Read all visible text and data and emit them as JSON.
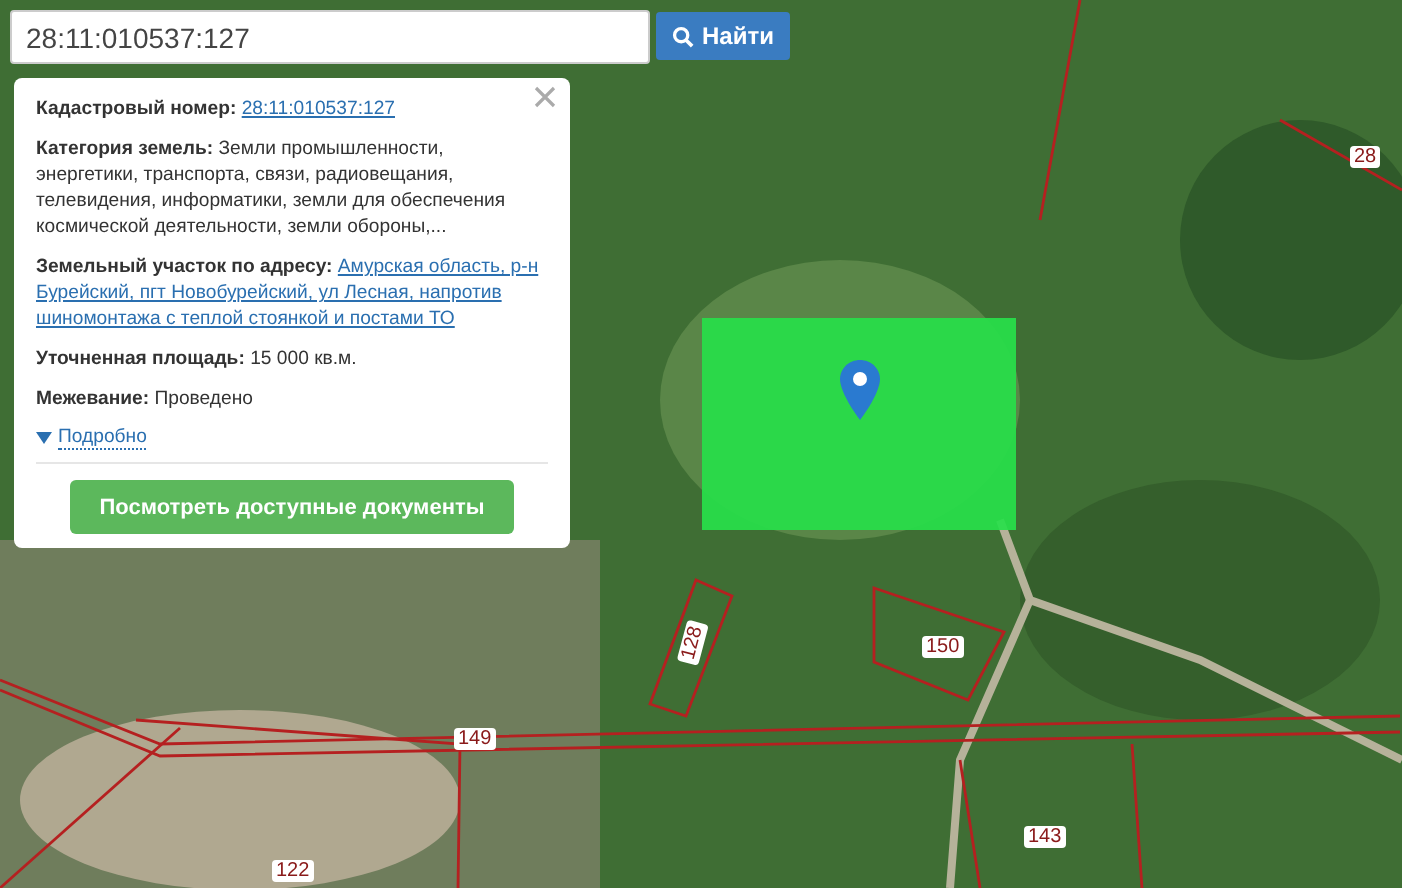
{
  "search": {
    "value": "28:11:010537:127",
    "button": "Найти"
  },
  "info_panel": {
    "fields": [
      {
        "label": "Кадастровый номер:",
        "value": "28:11:010537:127",
        "kind": "link"
      },
      {
        "label": "Категория земель:",
        "value": "Земли промышленности, энергетики, транспорта, связи, радиовещания, телевидения, информатики, земли для обеспечения космической деятельности, земли обороны,...",
        "kind": "text"
      },
      {
        "label": "Земельный участок по адресу:",
        "value": "Амурская область, р-н Бурейский, пгт Новобурейский, ул Лесная, напротив шиномонтажа с теплой стоянкой и постами ТО",
        "kind": "link"
      },
      {
        "label": "Уточненная площадь:",
        "value": "15 000 кв.м.",
        "kind": "text"
      },
      {
        "label": "Межевание:",
        "value": "Проведено",
        "kind": "text"
      }
    ],
    "details": {
      "label": "Подробно",
      "expanded": false
    },
    "action_button": "Посмотреть доступные документы"
  },
  "map": {
    "parcel_labels": [
      {
        "label": "28"
      },
      {
        "label": "128"
      },
      {
        "label": "150"
      },
      {
        "label": "149"
      },
      {
        "label": "143"
      },
      {
        "label": "122"
      }
    ]
  }
}
